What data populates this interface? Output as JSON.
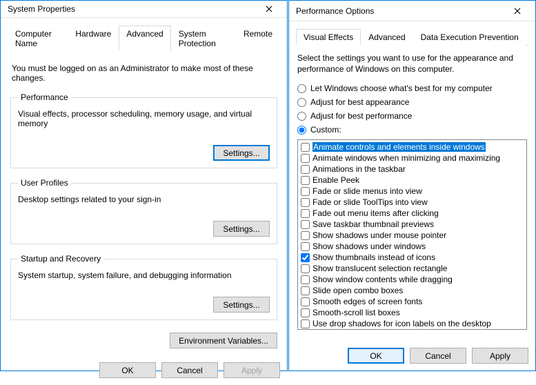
{
  "sysprops": {
    "title": "System Properties",
    "tabs": [
      "Computer Name",
      "Hardware",
      "Advanced",
      "System Protection",
      "Remote"
    ],
    "active_tab": 2,
    "notice": "You must be logged on as an Administrator to make most of these changes.",
    "groups": {
      "performance": {
        "legend": "Performance",
        "desc": "Visual effects, processor scheduling, memory usage, and virtual memory",
        "settings_btn": "Settings..."
      },
      "userprofiles": {
        "legend": "User Profiles",
        "desc": "Desktop settings related to your sign-in",
        "settings_btn": "Settings..."
      },
      "startup": {
        "legend": "Startup and Recovery",
        "desc": "System startup, system failure, and debugging information",
        "settings_btn": "Settings..."
      }
    },
    "envvars_btn": "Environment Variables...",
    "footer": {
      "ok": "OK",
      "cancel": "Cancel",
      "apply": "Apply"
    }
  },
  "perfopts": {
    "title": "Performance Options",
    "tabs": [
      "Visual Effects",
      "Advanced",
      "Data Execution Prevention"
    ],
    "active_tab": 0,
    "instruction": "Select the settings you want to use for the appearance and performance of Windows on this computer.",
    "radios": {
      "auto": "Let Windows choose what's best for my computer",
      "best_appearance": "Adjust for best appearance",
      "best_performance": "Adjust for best performance",
      "custom": "Custom:"
    },
    "selected_radio": "custom",
    "items": [
      {
        "label": "Animate controls and elements inside windows",
        "checked": false,
        "selected": true
      },
      {
        "label": "Animate windows when minimizing and maximizing",
        "checked": false,
        "selected": false
      },
      {
        "label": "Animations in the taskbar",
        "checked": false,
        "selected": false
      },
      {
        "label": "Enable Peek",
        "checked": false,
        "selected": false
      },
      {
        "label": "Fade or slide menus into view",
        "checked": false,
        "selected": false
      },
      {
        "label": "Fade or slide ToolTips into view",
        "checked": false,
        "selected": false
      },
      {
        "label": "Fade out menu items after clicking",
        "checked": false,
        "selected": false
      },
      {
        "label": "Save taskbar thumbnail previews",
        "checked": false,
        "selected": false
      },
      {
        "label": "Show shadows under mouse pointer",
        "checked": false,
        "selected": false
      },
      {
        "label": "Show shadows under windows",
        "checked": false,
        "selected": false
      },
      {
        "label": "Show thumbnails instead of icons",
        "checked": true,
        "selected": false
      },
      {
        "label": "Show translucent selection rectangle",
        "checked": false,
        "selected": false
      },
      {
        "label": "Show window contents while dragging",
        "checked": false,
        "selected": false
      },
      {
        "label": "Slide open combo boxes",
        "checked": false,
        "selected": false
      },
      {
        "label": "Smooth edges of screen fonts",
        "checked": false,
        "selected": false
      },
      {
        "label": "Smooth-scroll list boxes",
        "checked": false,
        "selected": false
      },
      {
        "label": "Use drop shadows for icon labels on the desktop",
        "checked": false,
        "selected": false
      }
    ],
    "footer": {
      "ok": "OK",
      "cancel": "Cancel",
      "apply": "Apply"
    }
  }
}
